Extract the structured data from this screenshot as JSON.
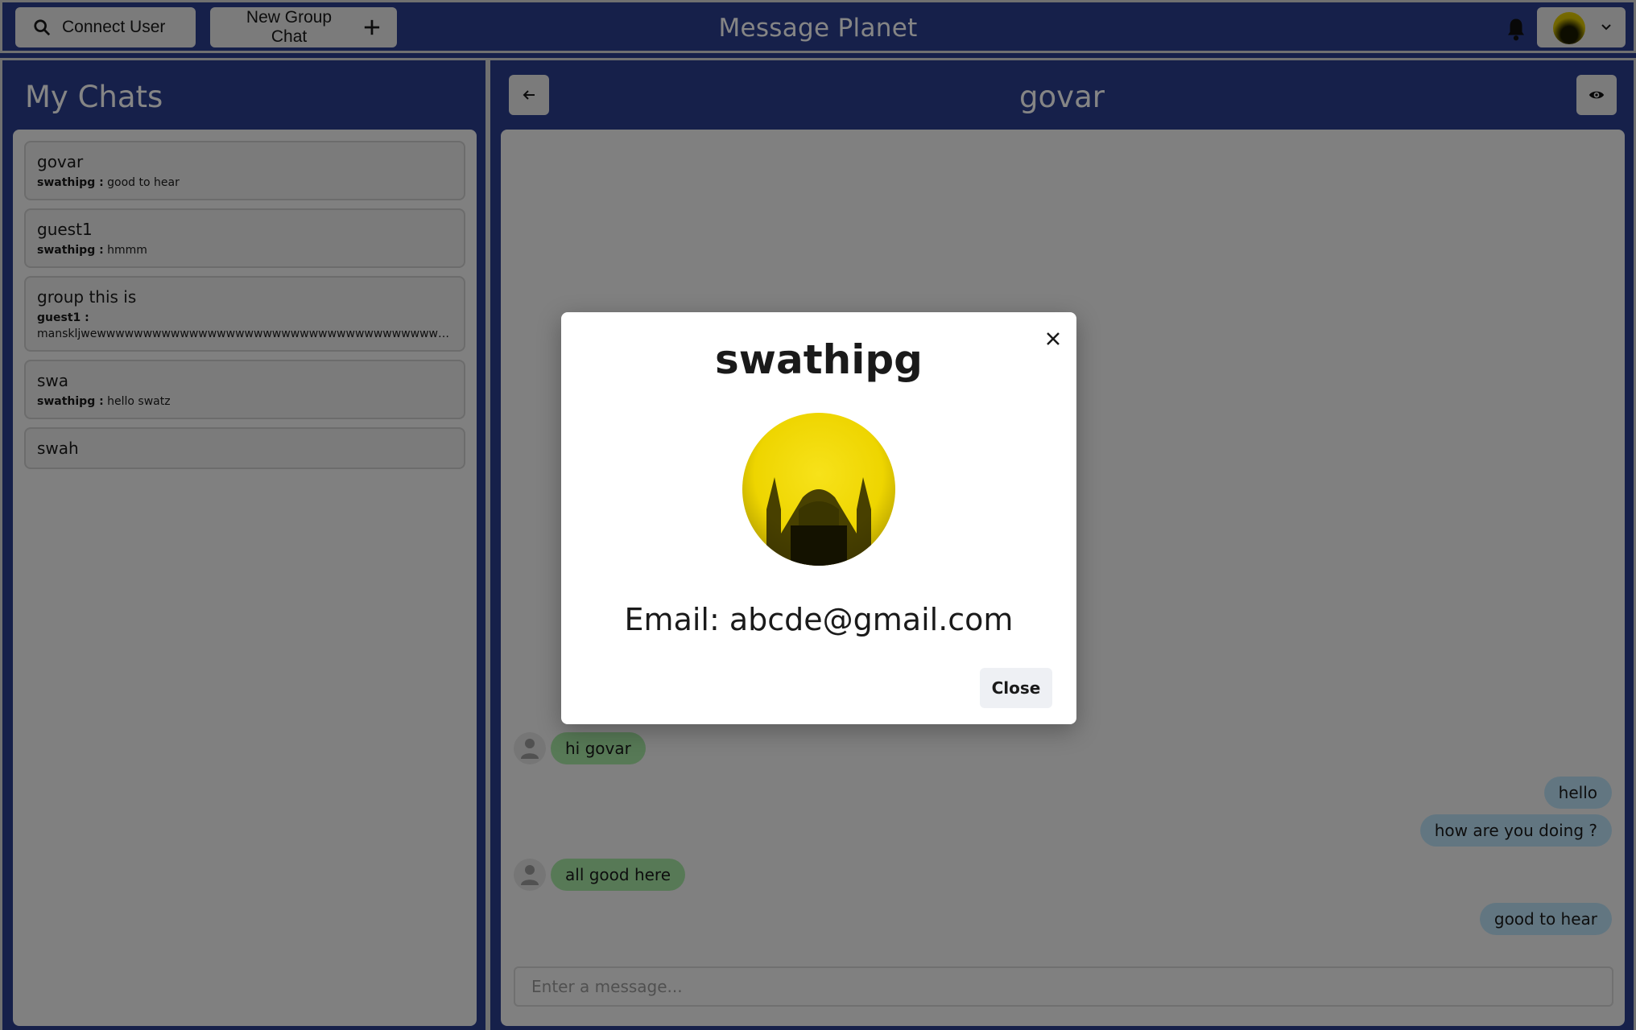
{
  "header": {
    "connect_user_label": "Connect User",
    "new_group_label": "New Group Chat",
    "app_title": "Message Planet"
  },
  "left_panel": {
    "title": "My Chats",
    "chats": [
      {
        "name": "govar",
        "sender": "swathipg :",
        "message": "good to hear"
      },
      {
        "name": "guest1",
        "sender": "swathipg :",
        "message": "hmmm"
      },
      {
        "name": "group this is",
        "sender": "guest1 :",
        "message": "manskljwewwwwwwwwwwwwwwwwwwwwwwwwwwwwwwwwwwwwwwwwqqqqqqqqqqq..."
      },
      {
        "name": "swa",
        "sender": "swathipg :",
        "message": "hello swatz"
      },
      {
        "name": "swah",
        "sender": "",
        "message": ""
      }
    ]
  },
  "chat": {
    "title": "govar",
    "messages": [
      {
        "text": "hi govar",
        "direction": "in"
      },
      {
        "text": "hello",
        "direction": "out"
      },
      {
        "text": "how are you doing ?",
        "direction": "out"
      },
      {
        "text": "all good here",
        "direction": "in"
      },
      {
        "text": "good to hear",
        "direction": "out"
      }
    ],
    "input_placeholder": "Enter a message..."
  },
  "modal": {
    "title": "swathipg",
    "email_line": "Email: abcde@gmail.com",
    "close_label": "Close"
  },
  "icons": {
    "search": "search-icon",
    "plus": "plus-icon",
    "bell": "bell-icon",
    "chevron": "chevron-down-icon",
    "back": "arrow-left-icon",
    "eye": "eye-icon",
    "close": "close-icon",
    "user": "user-placeholder-icon"
  },
  "colors": {
    "header_bg": "#2b3e8e",
    "incoming_bubble": "#a7e8a6",
    "outgoing_bubble": "#bde3f8",
    "panel_bg": "#f6f6f6"
  }
}
